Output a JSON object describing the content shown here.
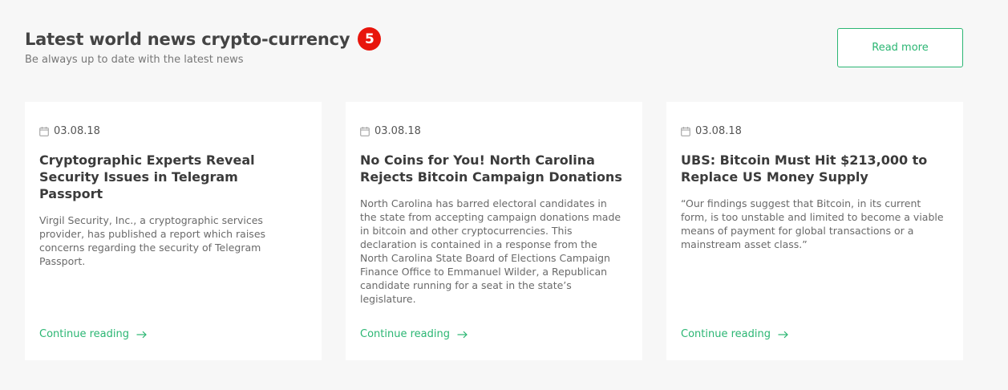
{
  "header": {
    "title": "Latest world news crypto-currency",
    "badge_count": "5",
    "subtitle": "Be always up to date with the latest news",
    "read_more_label": "Read more"
  },
  "colors": {
    "accent": "#2bb673",
    "badge": "#e8150c",
    "background": "#f7f7f7"
  },
  "cards": [
    {
      "date": "03.08.18",
      "title_line1": "Cryptographic Experts Reveal",
      "title_line2": "Security Issues in Telegram Passport",
      "excerpt": "Virgil Security, Inc., a cryptographic services provider, has published a report which raises concerns regarding the security of Telegram Passport.",
      "cta": "Continue reading"
    },
    {
      "date": "03.08.18",
      "title_line1": "No Coins for You! North Carolina",
      "title_line2": "Rejects Bitcoin Campaign Donations",
      "excerpt": "North Carolina has barred electoral candidates in the state from accepting campaign donations made in bitcoin and other cryptocurrencies. This declaration is contained in a response from the North Carolina State Board of Elections Campaign Finance Office to Emmanuel Wilder, a Republican candidate running for a seat in the state’s legislature.",
      "cta": "Continue reading"
    },
    {
      "date": "03.08.18",
      "title_line1": "UBS: Bitcoin Must Hit $213,000 to",
      "title_line2": "Replace US Money Supply",
      "excerpt": "“Our findings suggest that Bitcoin, in its current form, is too unstable and limited to become a viable means of payment for global transactions or a mainstream asset class.”",
      "cta": "Continue reading"
    }
  ]
}
